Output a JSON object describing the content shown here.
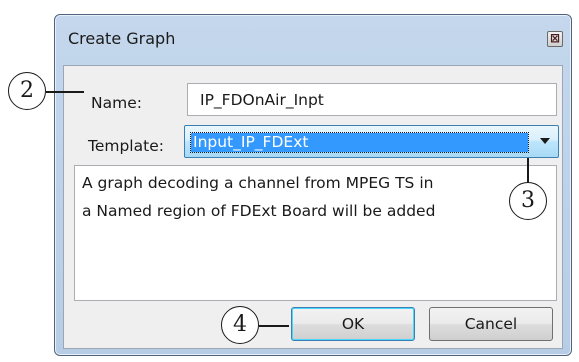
{
  "dialog": {
    "title": "Create Graph",
    "close_glyph": "⊠",
    "name_label": "Name:",
    "name_value": "IP_FDOnAir_Inpt",
    "template_label": "Template:",
    "template_value": "Input_IP_FDExt",
    "description_line1": "A graph decoding a channel from MPEG TS in",
    "description_line2": "a Named region of FDExt Board will be added",
    "ok_label": "OK",
    "cancel_label": "Cancel"
  },
  "callouts": {
    "name": "2",
    "template": "3",
    "ok": "4"
  },
  "icons": {
    "close": "close-icon",
    "dropdown": "chevron-down-icon"
  },
  "colors": {
    "frame": "#b7cde6",
    "selection": "#3399ff",
    "button_focus": "#3c7fb1"
  }
}
